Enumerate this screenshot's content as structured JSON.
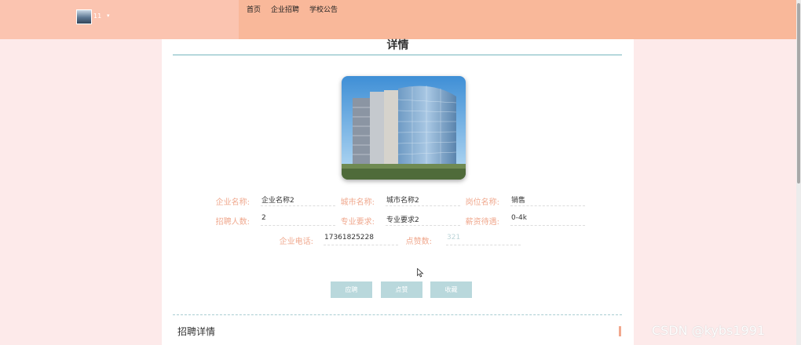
{
  "header": {
    "username": "11",
    "nav_items": [
      "首页",
      "企业招聘",
      "学校公告"
    ]
  },
  "detail": {
    "title": "详情",
    "fields": {
      "company_name": {
        "label": "企业名称:",
        "value": "企业名称2"
      },
      "city_name": {
        "label": "城市名称:",
        "value": "城市名称2"
      },
      "position_name": {
        "label": "岗位名称:",
        "value": "销售"
      },
      "headcount": {
        "label": "招聘人数:",
        "value": "2"
      },
      "major_requirement": {
        "label": "专业要求:",
        "value": "专业要求2"
      },
      "salary": {
        "label": "薪资待遇:",
        "value": "0-4k"
      },
      "company_phone": {
        "label": "企业电话:",
        "value": "17361825228"
      },
      "likes": {
        "label": "点赞数:",
        "value": "321"
      }
    },
    "buttons": {
      "apply": "应聘",
      "like": "点赞",
      "favorite": "收藏"
    },
    "section_title": "招聘详情"
  },
  "watermark": "CSDN @kybs1991",
  "colors": {
    "nav_bg": "#f9b89a",
    "label": "#f0a98f",
    "button": "#b9d8dc",
    "page_bg": "#fdeaea"
  }
}
